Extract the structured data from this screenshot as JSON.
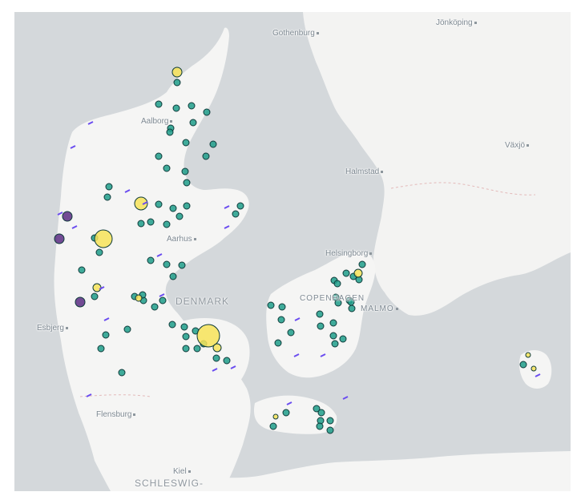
{
  "map": {
    "colors": {
      "water": "#d4d8db",
      "land": "#f5f5f4",
      "land_alt": "#efefee",
      "border": "#e3b9b9",
      "marker_teal": "#1f9e89",
      "marker_teal_stroke": "#0f3b3a",
      "marker_yellow": "#f7e358",
      "marker_purple": "#5a2d82",
      "line_violet": "#6a4cf0"
    },
    "labels": {
      "gothenburg": "Gothenburg",
      "jonkoping": "Jönköping",
      "aalborg": "Aalborg",
      "vaxjo": "Växjö",
      "halmstad": "Halmstad",
      "aarhus": "Aarhus",
      "helsingborg": "Helsingborg",
      "denmark": "DENMARK",
      "copenhagen": "COPENHAGEN",
      "malmo": "MALMO",
      "esbjerg": "Esbjerg",
      "flensburg": "Flensburg",
      "kiel": "Kiel",
      "schleswig": "SCHLESWIG-"
    }
  }
}
